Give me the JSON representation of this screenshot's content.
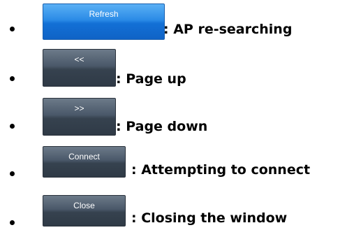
{
  "items": [
    {
      "button_label": "Refresh",
      "description": ": AP re-searching"
    },
    {
      "button_label": "<<",
      "description": ": Page up"
    },
    {
      "button_label": ">>",
      "description": ": Page down"
    },
    {
      "button_label": "Connect",
      "description": ": Attempting to connect"
    },
    {
      "button_label": "Close",
      "description": ": Closing the window"
    }
  ],
  "colors": {
    "refresh_button": "#1370d6",
    "dark_button": "#36424f",
    "text": "#000000"
  }
}
